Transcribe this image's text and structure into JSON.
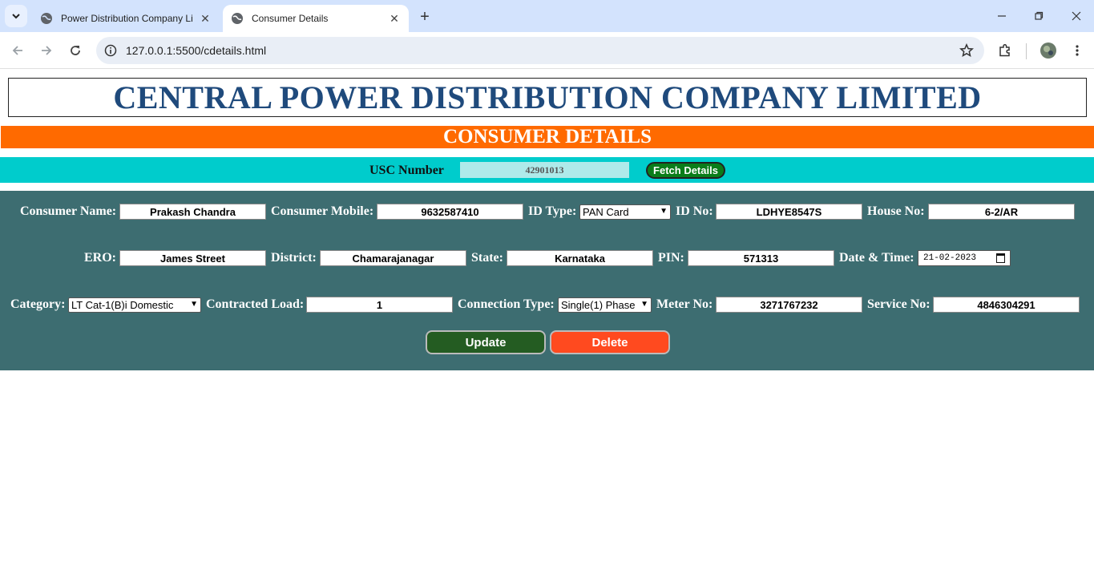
{
  "browser": {
    "tabs": [
      {
        "title": "Power Distribution Company Li",
        "active": false
      },
      {
        "title": "Consumer Details",
        "active": true
      }
    ],
    "url": "127.0.0.1:5500/cdetails.html"
  },
  "page": {
    "company_title": "CENTRAL POWER DISTRIBUTION COMPANY LIMITED",
    "section_title": "CONSUMER DETAILS",
    "usc": {
      "label": "USC Number",
      "value": "42901013",
      "fetch_label": "Fetch Details"
    },
    "form": {
      "consumer_name": {
        "label": "Consumer Name:",
        "value": "Prakash Chandra"
      },
      "consumer_mobile": {
        "label": "Consumer Mobile:",
        "value": "9632587410"
      },
      "id_type": {
        "label": "ID Type:",
        "value": "PAN Card"
      },
      "id_no": {
        "label": "ID No:",
        "value": "LDHYE8547S"
      },
      "house_no": {
        "label": "House No:",
        "value": "6-2/AR"
      },
      "ero": {
        "label": "ERO:",
        "value": "James Street"
      },
      "district": {
        "label": "District:",
        "value": "Chamarajanagar"
      },
      "state": {
        "label": "State:",
        "value": "Karnataka"
      },
      "pin": {
        "label": "PIN:",
        "value": "571313"
      },
      "date_time": {
        "label": "Date & Time:",
        "value": "21-02-2023"
      },
      "category": {
        "label": "Category:",
        "value": "LT Cat-1(B)i Domestic"
      },
      "contracted_load": {
        "label": "Contracted Load:",
        "value": "1"
      },
      "connection_type": {
        "label": "Connection Type:",
        "value": "Single(1) Phase"
      },
      "meter_no": {
        "label": "Meter No:",
        "value": "3271767232"
      },
      "service_no": {
        "label": "Service No:",
        "value": "4846304291"
      }
    },
    "buttons": {
      "update": "Update",
      "delete": "Delete"
    }
  },
  "colors": {
    "heading": "#1f4a7c",
    "orange_bar": "#ff6a00",
    "cyan_bar": "#00cccc",
    "form_bg": "#3d6d71",
    "update": "#245c22",
    "delete": "#ff4a1f"
  }
}
